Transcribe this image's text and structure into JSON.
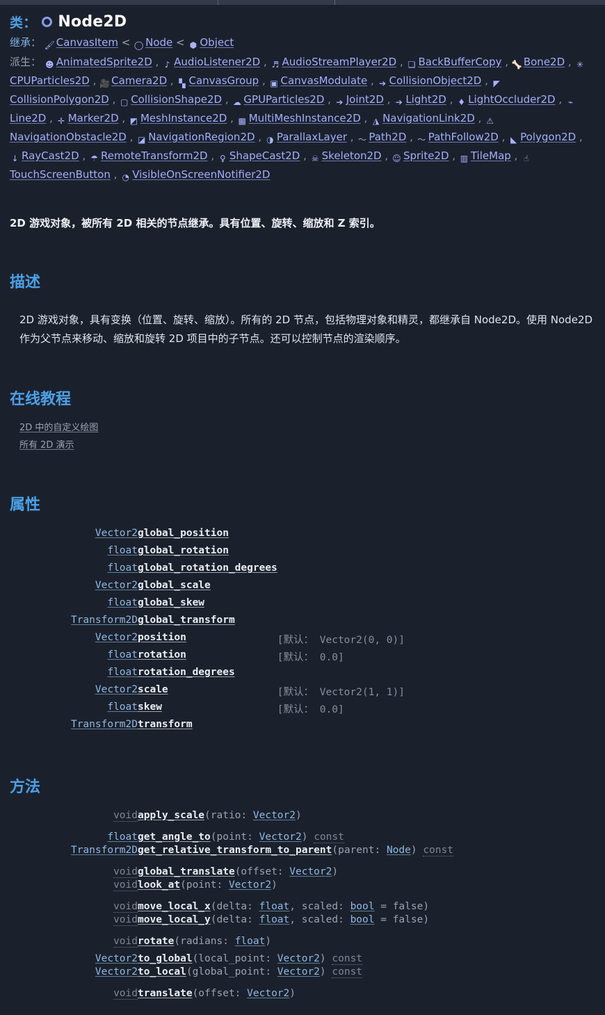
{
  "window": {
    "ticks": [
      313,
      481
    ]
  },
  "header": {
    "class_label": "类：",
    "class_name": "Node2D",
    "class_icon": "node2d-ring-icon",
    "inherits_label": "继承：",
    "inherits": [
      {
        "icon": "canvasitem-brush-icon",
        "glyph": "🖌",
        "name": "CanvasItem"
      },
      {
        "icon": "node-ring-icon",
        "glyph": "◯",
        "name": "Node"
      },
      {
        "icon": "object-cube-icon",
        "glyph": "⬢",
        "name": "Object"
      }
    ],
    "inherits_separator": "<",
    "derived_label": "派生：",
    "derived": [
      {
        "glyph": "☻",
        "name": "AnimatedSprite2D"
      },
      {
        "glyph": "♪",
        "name": "AudioListener2D"
      },
      {
        "glyph": "♬",
        "name": "AudioStreamPlayer2D"
      },
      {
        "glyph": "❏",
        "name": "BackBufferCopy"
      },
      {
        "glyph": "🦴",
        "name": "Bone2D"
      },
      {
        "glyph": "✳",
        "name": "CPUParticles2D"
      },
      {
        "glyph": "🎥",
        "name": "Camera2D"
      },
      {
        "glyph": "▚",
        "name": "CanvasGroup"
      },
      {
        "glyph": "▣",
        "name": "CanvasModulate"
      },
      {
        "glyph": "➔",
        "name": "CollisionObject2D"
      },
      {
        "glyph": "◤",
        "name": "CollisionPolygon2D"
      },
      {
        "glyph": "▢",
        "name": "CollisionShape2D"
      },
      {
        "glyph": "☁",
        "name": "GPUParticles2D"
      },
      {
        "glyph": "➔",
        "name": "Joint2D"
      },
      {
        "glyph": "➔",
        "name": "Light2D"
      },
      {
        "glyph": "♦",
        "name": "LightOccluder2D"
      },
      {
        "glyph": "⌁",
        "name": "Line2D"
      },
      {
        "glyph": "✛",
        "name": "Marker2D"
      },
      {
        "glyph": "◩",
        "name": "MeshInstance2D"
      },
      {
        "glyph": "▩",
        "name": "MultiMeshInstance2D"
      },
      {
        "glyph": "◮",
        "name": "NavigationLink2D"
      },
      {
        "glyph": "⚠",
        "name": "NavigationObstacle2D"
      },
      {
        "glyph": "◪",
        "name": "NavigationRegion2D"
      },
      {
        "glyph": "◑",
        "name": "ParallaxLayer"
      },
      {
        "glyph": "〜",
        "name": "Path2D"
      },
      {
        "glyph": "〜",
        "name": "PathFollow2D"
      },
      {
        "glyph": "◣",
        "name": "Polygon2D"
      },
      {
        "glyph": "↓",
        "name": "RayCast2D"
      },
      {
        "glyph": "☂",
        "name": "RemoteTransform2D"
      },
      {
        "glyph": "♀",
        "name": "ShapeCast2D"
      },
      {
        "glyph": "☠",
        "name": "Skeleton2D"
      },
      {
        "glyph": "☺",
        "name": "Sprite2D"
      },
      {
        "glyph": "▥",
        "name": "TileMap"
      },
      {
        "glyph": "☝",
        "name": "TouchScreenButton"
      },
      {
        "glyph": "◔",
        "name": "VisibleOnScreenNotifier2D"
      }
    ]
  },
  "brief": "2D 游戏对象，被所有 2D 相关的节点继承。具有位置、旋转、缩放和 Z 索引。",
  "sections": {
    "description_title": "描述",
    "description_body": "2D 游戏对象，具有变换（位置、旋转、缩放）。所有的 2D 节点，包括物理对象和精灵，都继承自 Node2D。使用 Node2D 作为父节点来移动、缩放和旋转 2D 项目中的子节点。还可以控制节点的渲染顺序。",
    "tutorials_title": "在线教程",
    "tutorials": [
      "2D 中的自定义绘图",
      "所有 2D 演示"
    ],
    "properties_title": "属性",
    "methods_title": "方法"
  },
  "properties": [
    {
      "type": "Vector2",
      "name": "global_position",
      "default": ""
    },
    {
      "type": "float",
      "name": "global_rotation",
      "default": ""
    },
    {
      "type": "float",
      "name": "global_rotation_degrees",
      "default": ""
    },
    {
      "type": "Vector2",
      "name": "global_scale",
      "default": ""
    },
    {
      "type": "float",
      "name": "global_skew",
      "default": ""
    },
    {
      "type": "Transform2D",
      "name": "global_transform",
      "default": ""
    },
    {
      "type": "Vector2",
      "name": "position",
      "default": "[默认： Vector2(0, 0)]"
    },
    {
      "type": "float",
      "name": "rotation",
      "default": "[默认： 0.0]"
    },
    {
      "type": "float",
      "name": "rotation_degrees",
      "default": ""
    },
    {
      "type": "Vector2",
      "name": "scale",
      "default": "[默认： Vector2(1, 1)]"
    },
    {
      "type": "float",
      "name": "skew",
      "default": "[默认： 0.0]"
    },
    {
      "type": "Transform2D",
      "name": "transform",
      "default": ""
    }
  ],
  "methods": [
    {
      "group": 0,
      "return": "void",
      "return_link": false,
      "name": "apply_scale",
      "args_prefix": "(ratio: ",
      "arg_type": "Vector2",
      "args_suffix": ")",
      "qualifier": ""
    },
    {
      "group": 1,
      "return": "float",
      "return_link": true,
      "name": "get_angle_to",
      "args_prefix": "(point: ",
      "arg_type": "Vector2",
      "args_suffix": ")",
      "qualifier": "const"
    },
    {
      "group": 1,
      "return": "Transform2D",
      "return_link": true,
      "name": "get_relative_transform_to_parent",
      "args_prefix": "(parent: ",
      "arg_type": "Node",
      "args_suffix": ")",
      "qualifier": "const"
    },
    {
      "group": 2,
      "return": "void",
      "return_link": false,
      "name": "global_translate",
      "args_prefix": "(offset: ",
      "arg_type": "Vector2",
      "args_suffix": ")",
      "qualifier": ""
    },
    {
      "group": 2,
      "return": "void",
      "return_link": false,
      "name": "look_at",
      "args_prefix": "(point: ",
      "arg_type": "Vector2",
      "args_suffix": ")",
      "qualifier": ""
    },
    {
      "group": 3,
      "return": "void",
      "return_link": false,
      "name": "move_local_x",
      "args_prefix": "(delta: ",
      "arg_type": "float",
      "args_mid": ", scaled: ",
      "arg_type2": "bool",
      "args_suffix": " = false)",
      "qualifier": ""
    },
    {
      "group": 3,
      "return": "void",
      "return_link": false,
      "name": "move_local_y",
      "args_prefix": "(delta: ",
      "arg_type": "float",
      "args_mid": ", scaled: ",
      "arg_type2": "bool",
      "args_suffix": " = false)",
      "qualifier": ""
    },
    {
      "group": 4,
      "return": "void",
      "return_link": false,
      "name": "rotate",
      "args_prefix": "(radians: ",
      "arg_type": "float",
      "args_suffix": ")",
      "qualifier": ""
    },
    {
      "group": 5,
      "return": "Vector2",
      "return_link": true,
      "name": "to_global",
      "args_prefix": "(local_point: ",
      "arg_type": "Vector2",
      "args_suffix": ")",
      "qualifier": "const"
    },
    {
      "group": 5,
      "return": "Vector2",
      "return_link": true,
      "name": "to_local",
      "args_prefix": "(global_point: ",
      "arg_type": "Vector2",
      "args_suffix": ")",
      "qualifier": "const"
    },
    {
      "group": 6,
      "return": "void",
      "return_link": false,
      "name": "translate",
      "args_prefix": "(offset: ",
      "arg_type": "Vector2",
      "args_suffix": ")",
      "qualifier": ""
    }
  ],
  "colors": {
    "background": "#1b212c",
    "topbar": "#333b4a",
    "heading_blue": "#4ba0e8",
    "link_purple": "#a3aefc",
    "type_blue": "#8fb8e4",
    "member_white": "#e9edf3",
    "muted_gray": "#7f8795"
  }
}
